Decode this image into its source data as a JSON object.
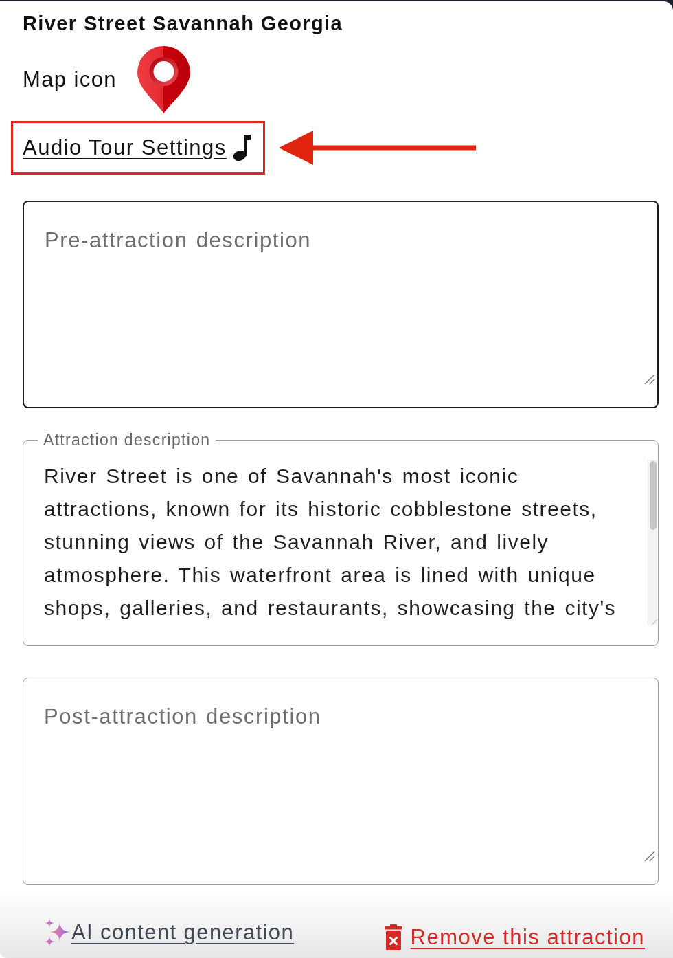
{
  "title": "River Street Savannah Georgia",
  "map_icon": {
    "label": "Map icon"
  },
  "audio_link": {
    "label": "Audio Tour Settings",
    "highlighted": true
  },
  "fields": [
    {
      "kind": "textarea",
      "placeholder": "Pre-attraction description",
      "focused": true
    },
    {
      "kind": "outlined",
      "label": "Attraction description",
      "value": "River Street is one of Savannah's most iconic attractions, known for its historic cobblestone streets, stunning views of the Savannah River, and lively atmosphere. This waterfront area is lined with unique shops, galleries, and restaurants, showcasing the city's",
      "focused": false
    },
    {
      "kind": "textarea",
      "placeholder": "Post-attraction description",
      "focused": false
    }
  ],
  "footer": {
    "ai_link": "AI content generation",
    "remove_link": "Remove this attraction"
  }
}
